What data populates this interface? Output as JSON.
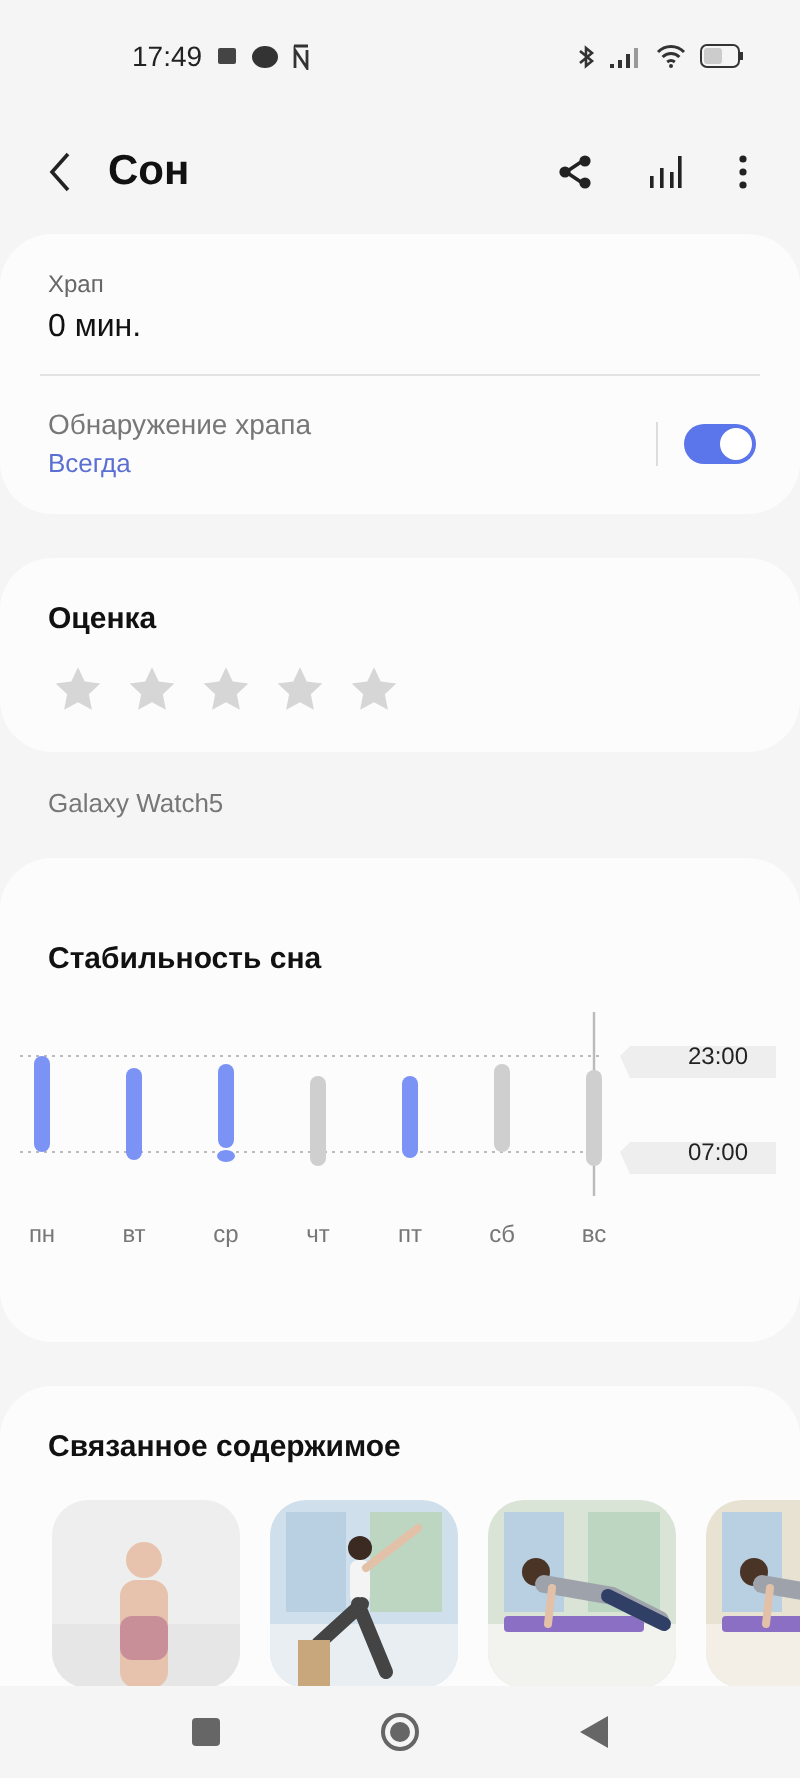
{
  "status_bar": {
    "time": "17:49"
  },
  "header": {
    "title": "Сон"
  },
  "snoring": {
    "label": "Храп",
    "value": "0 мин.",
    "detection_label": "Обнаружение храпа",
    "detection_value": "Всегда",
    "detection_on": true
  },
  "rating": {
    "title": "Оценка",
    "stars": 0
  },
  "device": "Galaxy Watch5",
  "stability": {
    "title": "Стабильность сна",
    "line_labels": [
      "23:00",
      "07:00"
    ],
    "days": [
      {
        "label": "пн",
        "color": "#7b93f4"
      },
      {
        "label": "вт",
        "color": "#7b93f4"
      },
      {
        "label": "ср",
        "color": "#7b93f4"
      },
      {
        "label": "чт",
        "color": "#cfcfcf"
      },
      {
        "label": "пт",
        "color": "#7b93f4"
      },
      {
        "label": "сб",
        "color": "#cfcfcf"
      },
      {
        "label": "вс",
        "color": "#cfcfcf"
      }
    ]
  },
  "related": {
    "title": "Связанное содержимое"
  }
}
